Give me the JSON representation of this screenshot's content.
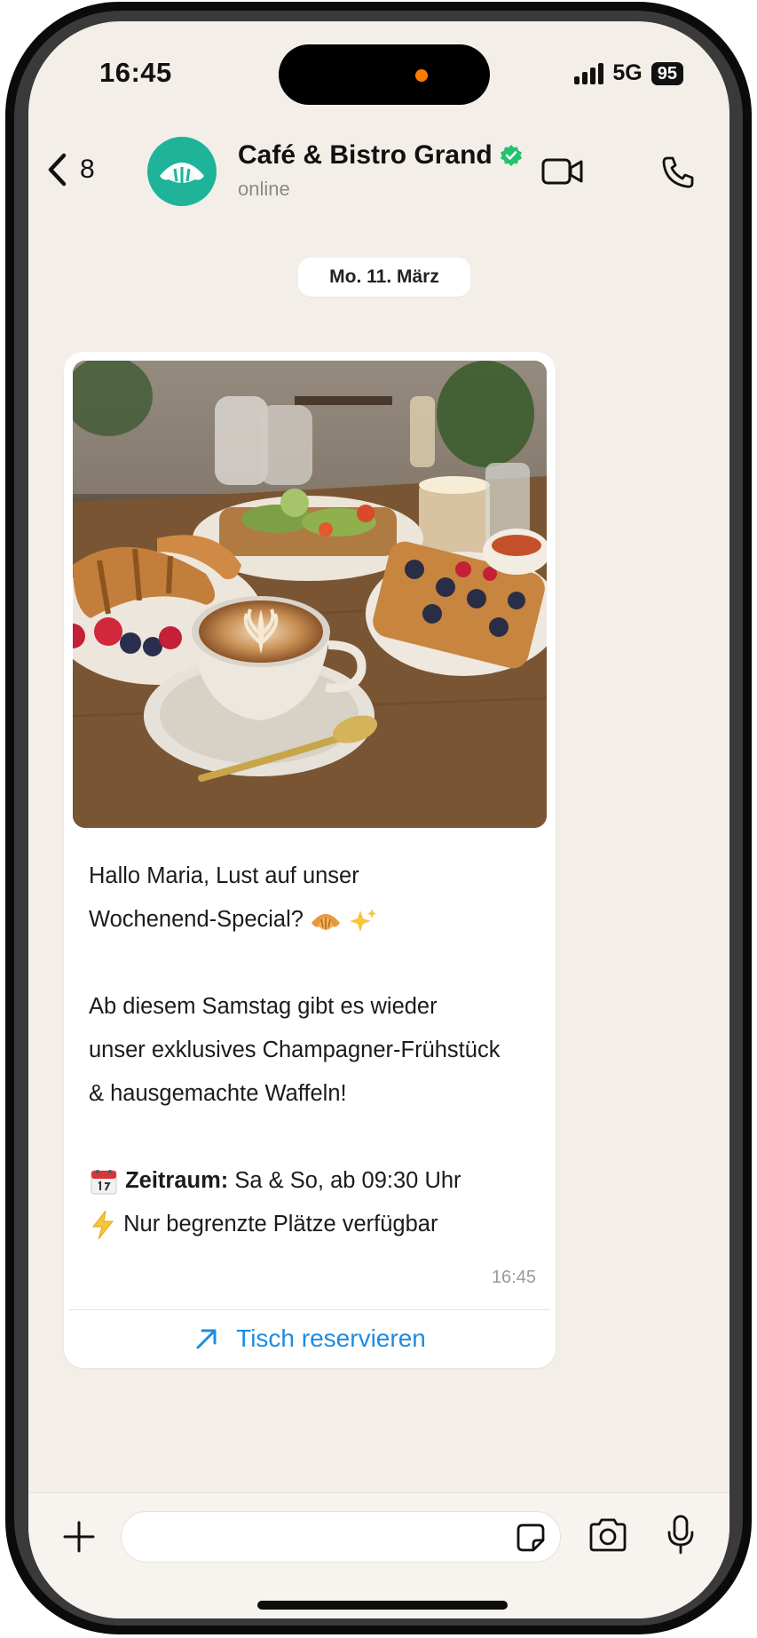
{
  "status_bar": {
    "time": "16:45",
    "network": "5G",
    "battery": "95"
  },
  "header": {
    "back_count": "8",
    "contact_name": "Café & Bistro Grand",
    "contact_status": "online",
    "icons": [
      "chevron-left-icon",
      "croissant-icon",
      "verified-badge-icon",
      "video-camera-icon",
      "phone-icon"
    ]
  },
  "chat": {
    "date_label": "Mo. 11. März",
    "message": {
      "line1": "Hallo Maria, Lust auf unser",
      "line2": "Wochenend-Special?",
      "line3": "Ab diesem Samstag gibt es wieder",
      "line4": "unser exklusives Champagner-Frühstück",
      "line5": "& hausgemachte Waffeln!",
      "period_label": "Zeitraum:",
      "period_value": "Sa & So, ab 09:30 Uhr",
      "seats_note": "Nur begrenzte Plätze verfügbar",
      "time": "16:45"
    },
    "action_button": "Tisch reservieren"
  },
  "input_bar": {
    "icons": [
      "plus-icon",
      "sticker-icon",
      "camera-icon",
      "microphone-icon"
    ]
  },
  "colors": {
    "accent_blue": "#1d8ce0",
    "avatar_teal": "#1fb39a",
    "verified_green": "#25c26e",
    "chat_background": "#f3efe8"
  }
}
